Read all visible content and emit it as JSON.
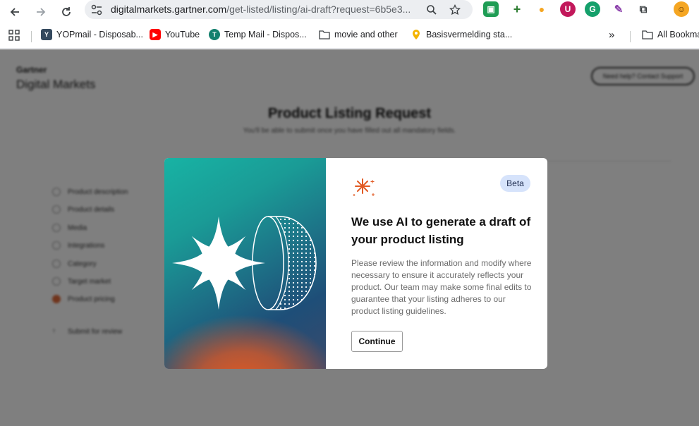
{
  "browser": {
    "url_host": "digitalmarkets.gartner.com",
    "url_path": "/get-listed/listing/ai-draft?request=6b5e3...",
    "bookmarks": [
      {
        "label": "YOPmail - Disposab...",
        "icon": "yopmail-icon"
      },
      {
        "label": "YouTube",
        "icon": "youtube-icon"
      },
      {
        "label": "Temp Mail - Dispos...",
        "icon": "tempmail-icon"
      },
      {
        "label": "movie and other",
        "icon": "folder-icon"
      },
      {
        "label": "Basisvermelding sta...",
        "icon": "location-pin-icon"
      }
    ],
    "all_bookmarks_label": "All Bookma"
  },
  "page": {
    "brand_line1": "Gartner",
    "brand_line2": "Digital Markets",
    "help_button": "Need help? Contact Support",
    "title": "Product Listing Request",
    "subtitle": "You'll be able to submit once you have filled out all mandatory fields.",
    "steps": [
      "Product description",
      "Product details",
      "Media",
      "Integrations",
      "Category",
      "Target market",
      "Product pricing",
      "Submit for review"
    ]
  },
  "modal": {
    "badge": "Beta",
    "title": "We use AI to generate a draft of your product listing",
    "body": "Please review the information and modify where necessary to ensure it accurately reflects your product. Our team may make some final edits to guarantee that your listing adheres to our product listing guidelines.",
    "continue_label": "Continue"
  },
  "colors": {
    "accent_orange": "#e25a23",
    "badge_bg": "#d6e3fb",
    "teal": "#18b3a4"
  }
}
